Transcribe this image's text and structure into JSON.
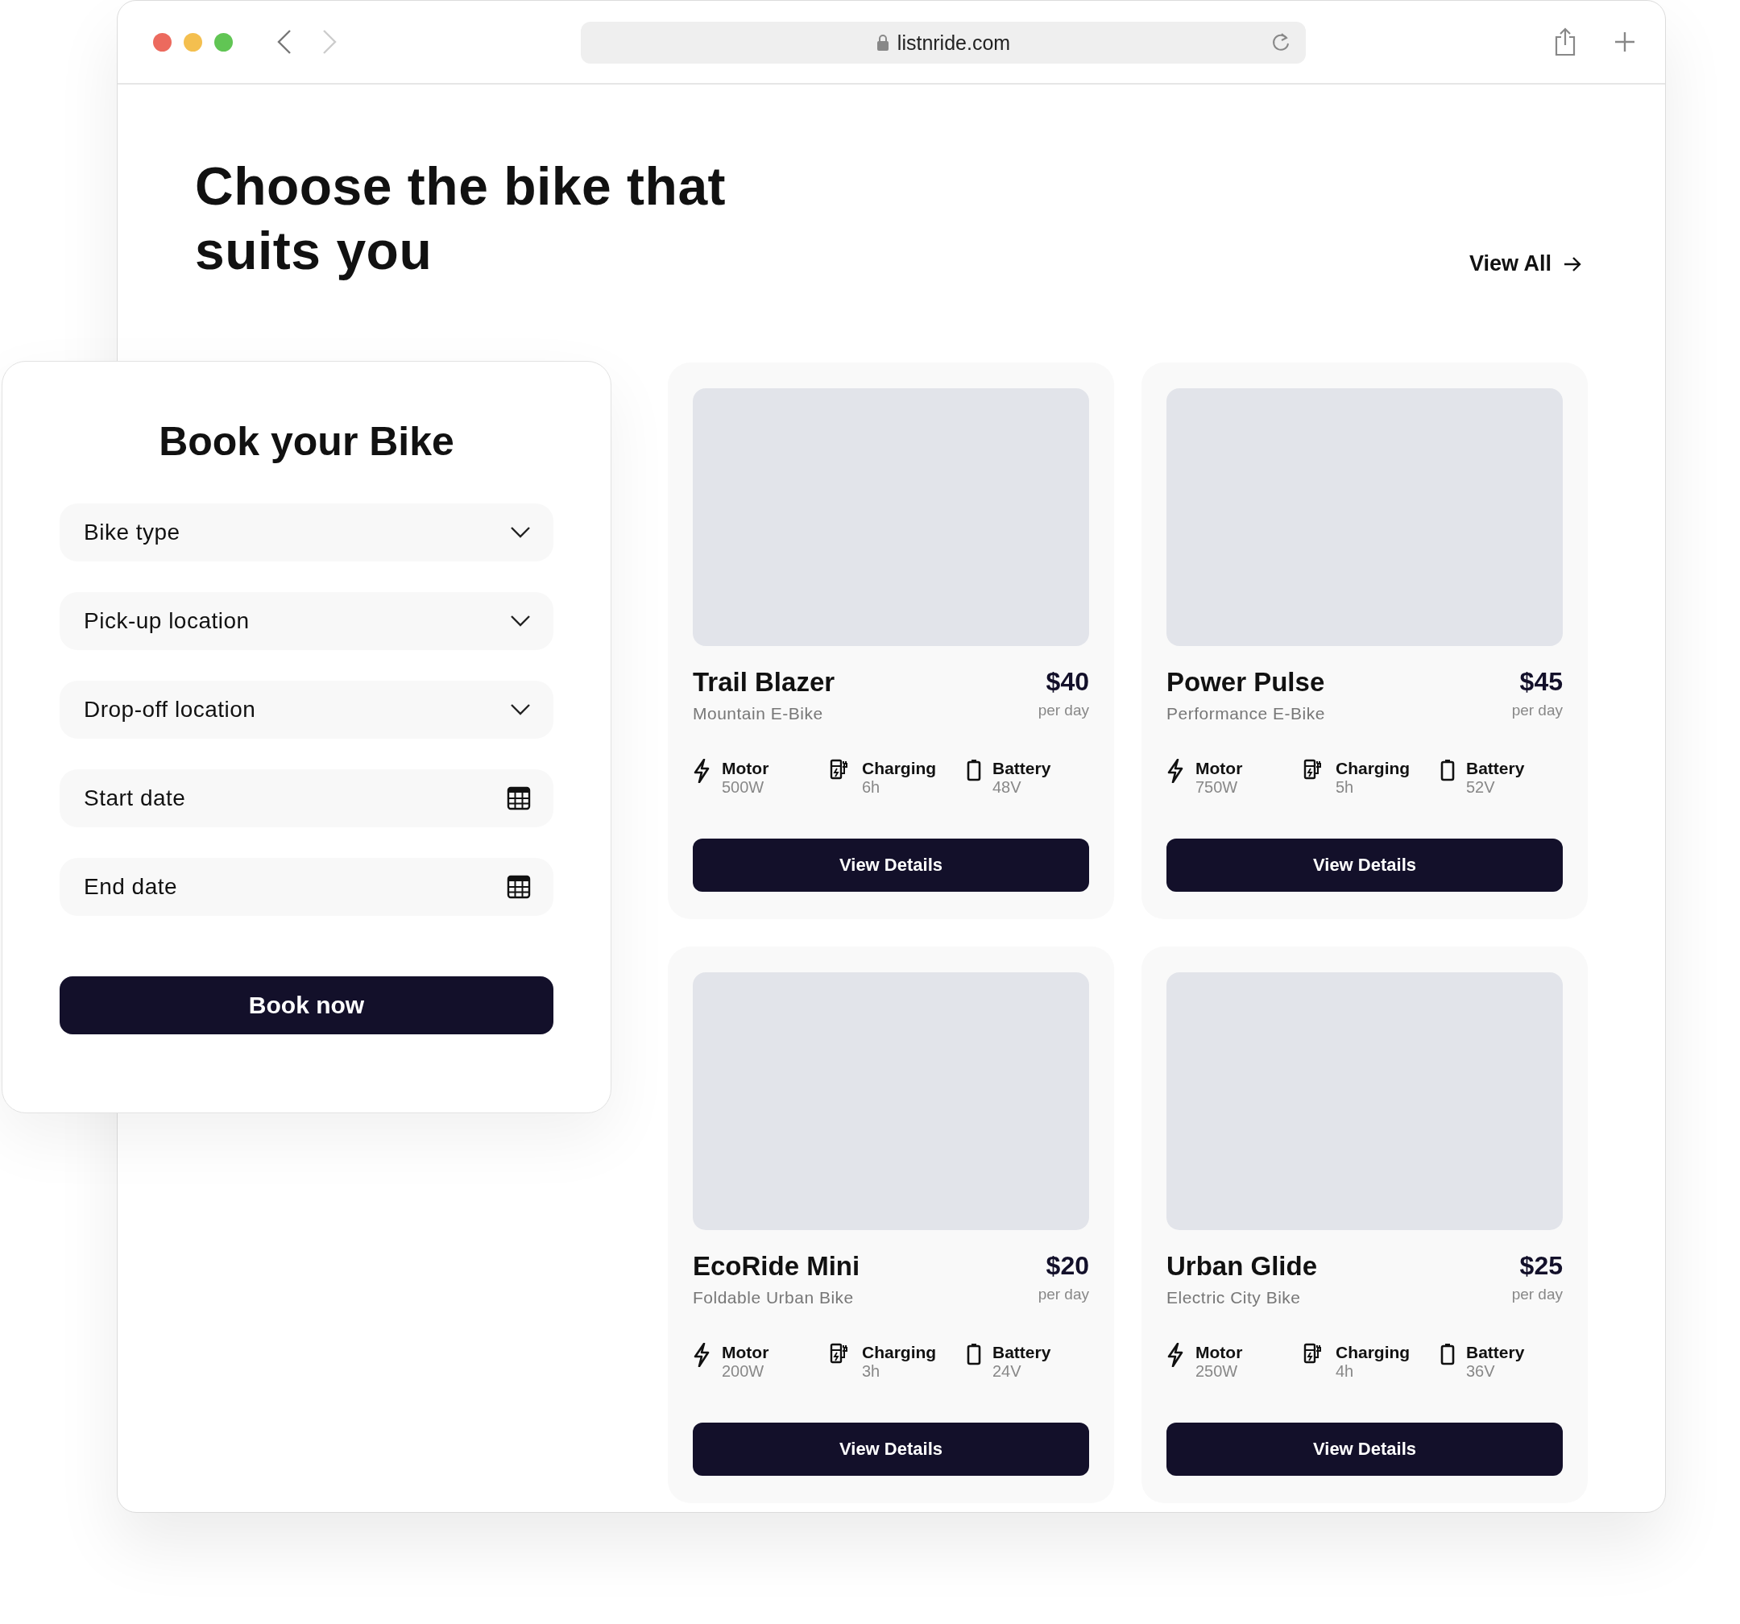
{
  "browser": {
    "url": "listnride.com"
  },
  "heading": "Choose the bike that suits you",
  "view_all": "View All",
  "booking": {
    "title": "Book your Bike",
    "fields": [
      {
        "kind": "select",
        "placeholder": "Bike type"
      },
      {
        "kind": "select",
        "placeholder": "Pick-up location"
      },
      {
        "kind": "select",
        "placeholder": "Drop-off location"
      },
      {
        "kind": "date",
        "placeholder": "Start date"
      },
      {
        "kind": "date",
        "placeholder": "End date"
      }
    ],
    "button": "Book now"
  },
  "bikes": [
    {
      "name": "Trail Blazer",
      "type": "Mountain E-Bike",
      "price": "$40",
      "period": "per day",
      "specs": [
        {
          "kind": "motor",
          "label": "Motor",
          "value": "500W"
        },
        {
          "kind": "charging",
          "label": "Charging",
          "value": "6h"
        },
        {
          "kind": "battery",
          "label": "Battery",
          "value": "48V"
        }
      ],
      "button": "View Details"
    },
    {
      "name": "Power Pulse",
      "type": "Performance E-Bike",
      "price": "$45",
      "period": "per day",
      "specs": [
        {
          "kind": "motor",
          "label": "Motor",
          "value": "750W"
        },
        {
          "kind": "charging",
          "label": "Charging",
          "value": "5h"
        },
        {
          "kind": "battery",
          "label": "Battery",
          "value": "52V"
        }
      ],
      "button": "View Details"
    },
    {
      "name": "EcoRide Mini",
      "type": "Foldable Urban Bike",
      "price": "$20",
      "period": "per day",
      "specs": [
        {
          "kind": "motor",
          "label": "Motor",
          "value": "200W"
        },
        {
          "kind": "charging",
          "label": "Charging",
          "value": "3h"
        },
        {
          "kind": "battery",
          "label": "Battery",
          "value": "24V"
        }
      ],
      "button": "View Details"
    },
    {
      "name": "Urban Glide",
      "type": "Electric City Bike",
      "price": "$25",
      "period": "per day",
      "specs": [
        {
          "kind": "motor",
          "label": "Motor",
          "value": "250W"
        },
        {
          "kind": "charging",
          "label": "Charging",
          "value": "4h"
        },
        {
          "kind": "battery",
          "label": "Battery",
          "value": "36V"
        }
      ],
      "button": "View Details"
    }
  ]
}
